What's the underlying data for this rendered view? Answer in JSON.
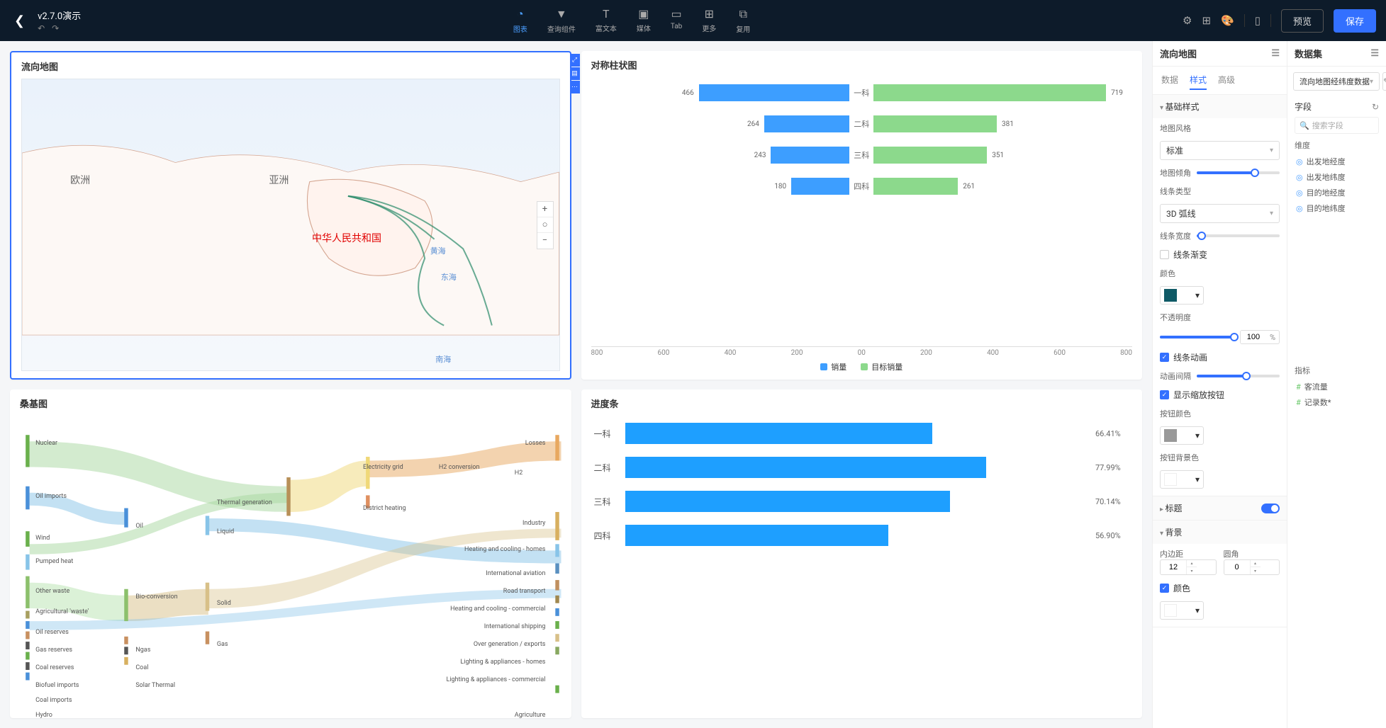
{
  "header": {
    "title": "v2.7.0演示",
    "tools": [
      {
        "label": "图表",
        "active": true
      },
      {
        "label": "查询组件"
      },
      {
        "label": "富文本"
      },
      {
        "label": "媒体"
      },
      {
        "label": "Tab"
      },
      {
        "label": "更多"
      },
      {
        "label": "复用"
      }
    ],
    "preview_btn": "预览",
    "save_btn": "保存"
  },
  "panels": {
    "map": {
      "title": "流向地图",
      "labels": {
        "europe": "欧洲",
        "asia": "亚洲",
        "china": "中华人民共和国",
        "yellow_sea": "黄海",
        "east_sea": "东海",
        "south_sea": "南海"
      }
    },
    "bar": {
      "title": "对称柱状图",
      "axis_left": [
        "800",
        "600",
        "400",
        "200",
        "0"
      ],
      "axis_right": [
        "0",
        "200",
        "400",
        "600",
        "800"
      ],
      "legend": [
        {
          "label": "销量",
          "color": "#3d9eff"
        },
        {
          "label": "目标销量",
          "color": "#8cd98c"
        }
      ]
    },
    "sankey": {
      "title": "桑基图",
      "nodes_left": [
        "Nuclear",
        "Oil imports",
        "Wind",
        "Pumped heat",
        "Other waste",
        "Agricultural 'waste'",
        "Oil reserves",
        "Gas reserves",
        "Coal reserves",
        "Biofuel imports",
        "Coal imports",
        "Hydro"
      ],
      "nodes_col2": [
        "Oil",
        "Bio-conversion",
        "Ngas",
        "Coal",
        "Solar Thermal"
      ],
      "nodes_col3": [
        "Thermal generation",
        "Liquid",
        "Solid",
        "Gas"
      ],
      "nodes_col4": [
        "Electricity grid",
        "District heating"
      ],
      "nodes_col5": [
        "H2 conversion"
      ],
      "nodes_col6": [
        "H2"
      ],
      "nodes_right": [
        "Losses",
        "Industry",
        "Heating and cooling - homes",
        "International aviation",
        "Road transport",
        "Heating and cooling - commercial",
        "International shipping",
        "Over generation / exports",
        "Lighting & appliances - homes",
        "Lighting & appliances - commercial",
        "Agriculture"
      ]
    },
    "progress": {
      "title": "进度条"
    }
  },
  "chart_data": [
    {
      "type": "bar",
      "title": "对称柱状图",
      "orientation": "horizontal-diverging",
      "categories": [
        "一科",
        "二科",
        "三科",
        "四科"
      ],
      "series": [
        {
          "name": "销量",
          "values": [
            466,
            264,
            243,
            180
          ],
          "color": "#3d9eff"
        },
        {
          "name": "目标销量",
          "values": [
            719,
            381,
            351,
            261
          ],
          "color": "#8cd98c"
        }
      ],
      "xlim_left": [
        0,
        800
      ],
      "xlim_right": [
        0,
        800
      ]
    },
    {
      "type": "bar",
      "title": "进度条",
      "orientation": "horizontal",
      "categories": [
        "一科",
        "二科",
        "三科",
        "四科"
      ],
      "values_pct": [
        66.41,
        77.99,
        70.14,
        56.9
      ],
      "color": "#1e9fff"
    }
  ],
  "side_panel": {
    "title": "流向地图",
    "tabs": [
      "数据",
      "样式",
      "高级"
    ],
    "active_tab": 1,
    "basic_style": {
      "section": "基础样式",
      "map_style_label": "地图风格",
      "map_style_value": "标准",
      "angle_label": "地图倾角",
      "line_type_label": "线条类型",
      "line_type_value": "3D 弧线",
      "line_width_label": "线条宽度",
      "line_gradient": "线条渐变",
      "color_label": "颜色",
      "color_value": "#0f5a66",
      "opacity_label": "不透明度",
      "opacity_value": "100",
      "opacity_unit": "%",
      "line_anim": "线条动画",
      "anim_interval": "动画间隔",
      "show_zoom": "显示缩放按钮",
      "btn_color_label": "按钮颜色",
      "btn_color_value": "#999999",
      "btn_bg_label": "按钮背景色"
    },
    "title_section": {
      "label": "标题"
    },
    "bg_section": {
      "label": "背景",
      "padding_label": "内边距",
      "padding_value": "12",
      "radius_label": "圆角",
      "radius_value": "0",
      "color_label": "颜色"
    }
  },
  "dataset_panel": {
    "title": "数据集",
    "selected": "流向地图经纬度数据",
    "field_label": "字段",
    "search_placeholder": "搜索字段",
    "dim_label": "维度",
    "metric_label": "指标",
    "dims": [
      "出发地经度",
      "出发地纬度",
      "目的地经度",
      "目的地纬度"
    ],
    "metrics": [
      "客流量",
      "记录数*"
    ]
  }
}
